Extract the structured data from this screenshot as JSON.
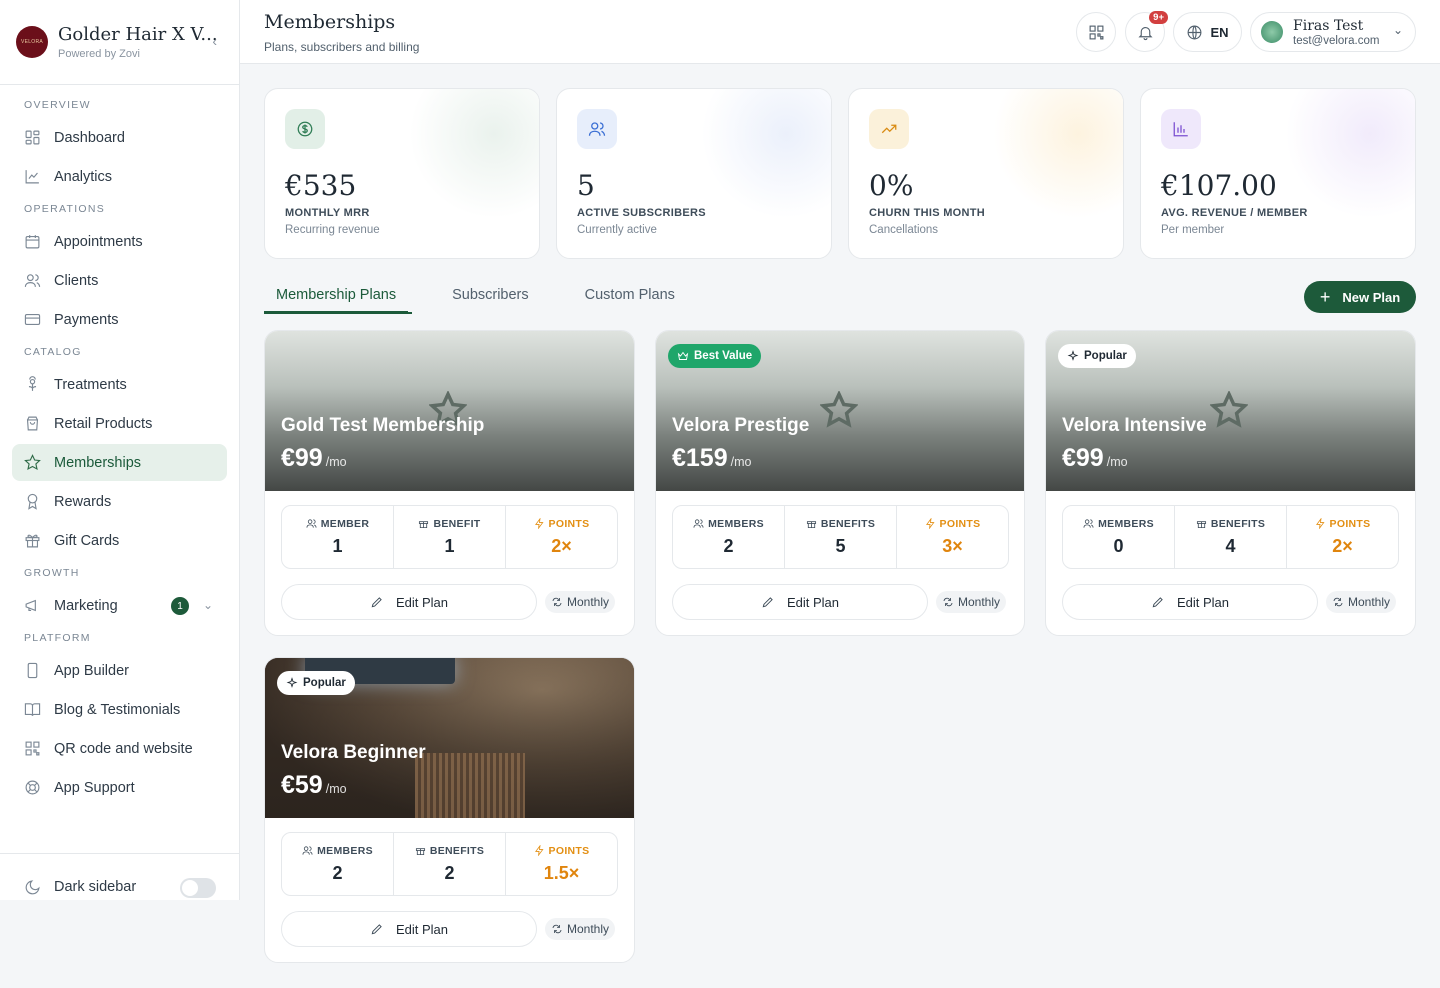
{
  "brand": {
    "name": "Golder Hair X V...",
    "powered_by": "Powered by Zovi",
    "logo_text": "GOLDEN HAIR VELORA"
  },
  "sidebar": {
    "sections": {
      "overview": "OVERVIEW",
      "operations": "OPERATIONS",
      "catalog": "CATALOG",
      "growth": "GROWTH",
      "platform": "PLATFORM"
    },
    "items": {
      "dashboard": "Dashboard",
      "analytics": "Analytics",
      "appointments": "Appointments",
      "clients": "Clients",
      "payments": "Payments",
      "treatments": "Treatments",
      "retail": "Retail Products",
      "memberships": "Memberships",
      "rewards": "Rewards",
      "giftcards": "Gift Cards",
      "marketing": "Marketing",
      "marketing_count": "1",
      "appbuilder": "App Builder",
      "blog": "Blog & Testimonials",
      "qr": "QR code and website",
      "support": "App Support"
    },
    "dark_sidebar": "Dark sidebar"
  },
  "header": {
    "title": "Memberships",
    "subtitle": "Plans, subscribers and billing",
    "notifications": "9+",
    "language": "EN",
    "user_name": "Firas Test",
    "user_email": "test@velora.com"
  },
  "stats": [
    {
      "value": "€535",
      "label": "MONTHLY MRR",
      "sub": "Recurring revenue",
      "icon": "dollar-icon",
      "color": "#2f7d55"
    },
    {
      "value": "5",
      "label": "ACTIVE SUBSCRIBERS",
      "sub": "Currently active",
      "icon": "users-icon",
      "color": "#3b6fd4"
    },
    {
      "value": "0%",
      "label": "CHURN THIS MONTH",
      "sub": "Cancellations",
      "icon": "trend-up-icon",
      "color": "#d98b12"
    },
    {
      "value": "€107.00",
      "label": "AVG. REVENUE / MEMBER",
      "sub": "Per member",
      "icon": "bar-chart-icon",
      "color": "#7b4fd1"
    }
  ],
  "tabs": [
    "Membership Plans",
    "Subscribers",
    "Custom Plans"
  ],
  "new_plan": "New Plan",
  "plans": [
    {
      "name": "Gold Test Membership",
      "price": "€99",
      "per": "/mo",
      "badge": "",
      "members_label": "MEMBER",
      "members": "1",
      "benefits_label": "BENEFIT",
      "benefits": "1",
      "points_label": "POINTS",
      "points": "2×",
      "edit": "Edit Plan",
      "cycle": "Monthly"
    },
    {
      "name": "Velora Prestige",
      "price": "€159",
      "per": "/mo",
      "badge": "Best Value",
      "members_label": "MEMBERS",
      "members": "2",
      "benefits_label": "BENEFITS",
      "benefits": "5",
      "points_label": "POINTS",
      "points": "3×",
      "edit": "Edit Plan",
      "cycle": "Monthly"
    },
    {
      "name": "Velora Intensive",
      "price": "€99",
      "per": "/mo",
      "badge": "Popular",
      "members_label": "MEMBERS",
      "members": "0",
      "benefits_label": "BENEFITS",
      "benefits": "4",
      "points_label": "POINTS",
      "points": "2×",
      "edit": "Edit Plan",
      "cycle": "Monthly"
    },
    {
      "name": "Velora Beginner",
      "price": "€59",
      "per": "/mo",
      "badge": "Popular",
      "members_label": "MEMBERS",
      "members": "2",
      "benefits_label": "BENEFITS",
      "benefits": "2",
      "points_label": "POINTS",
      "points": "1.5×",
      "edit": "Edit Plan",
      "cycle": "Monthly"
    }
  ]
}
